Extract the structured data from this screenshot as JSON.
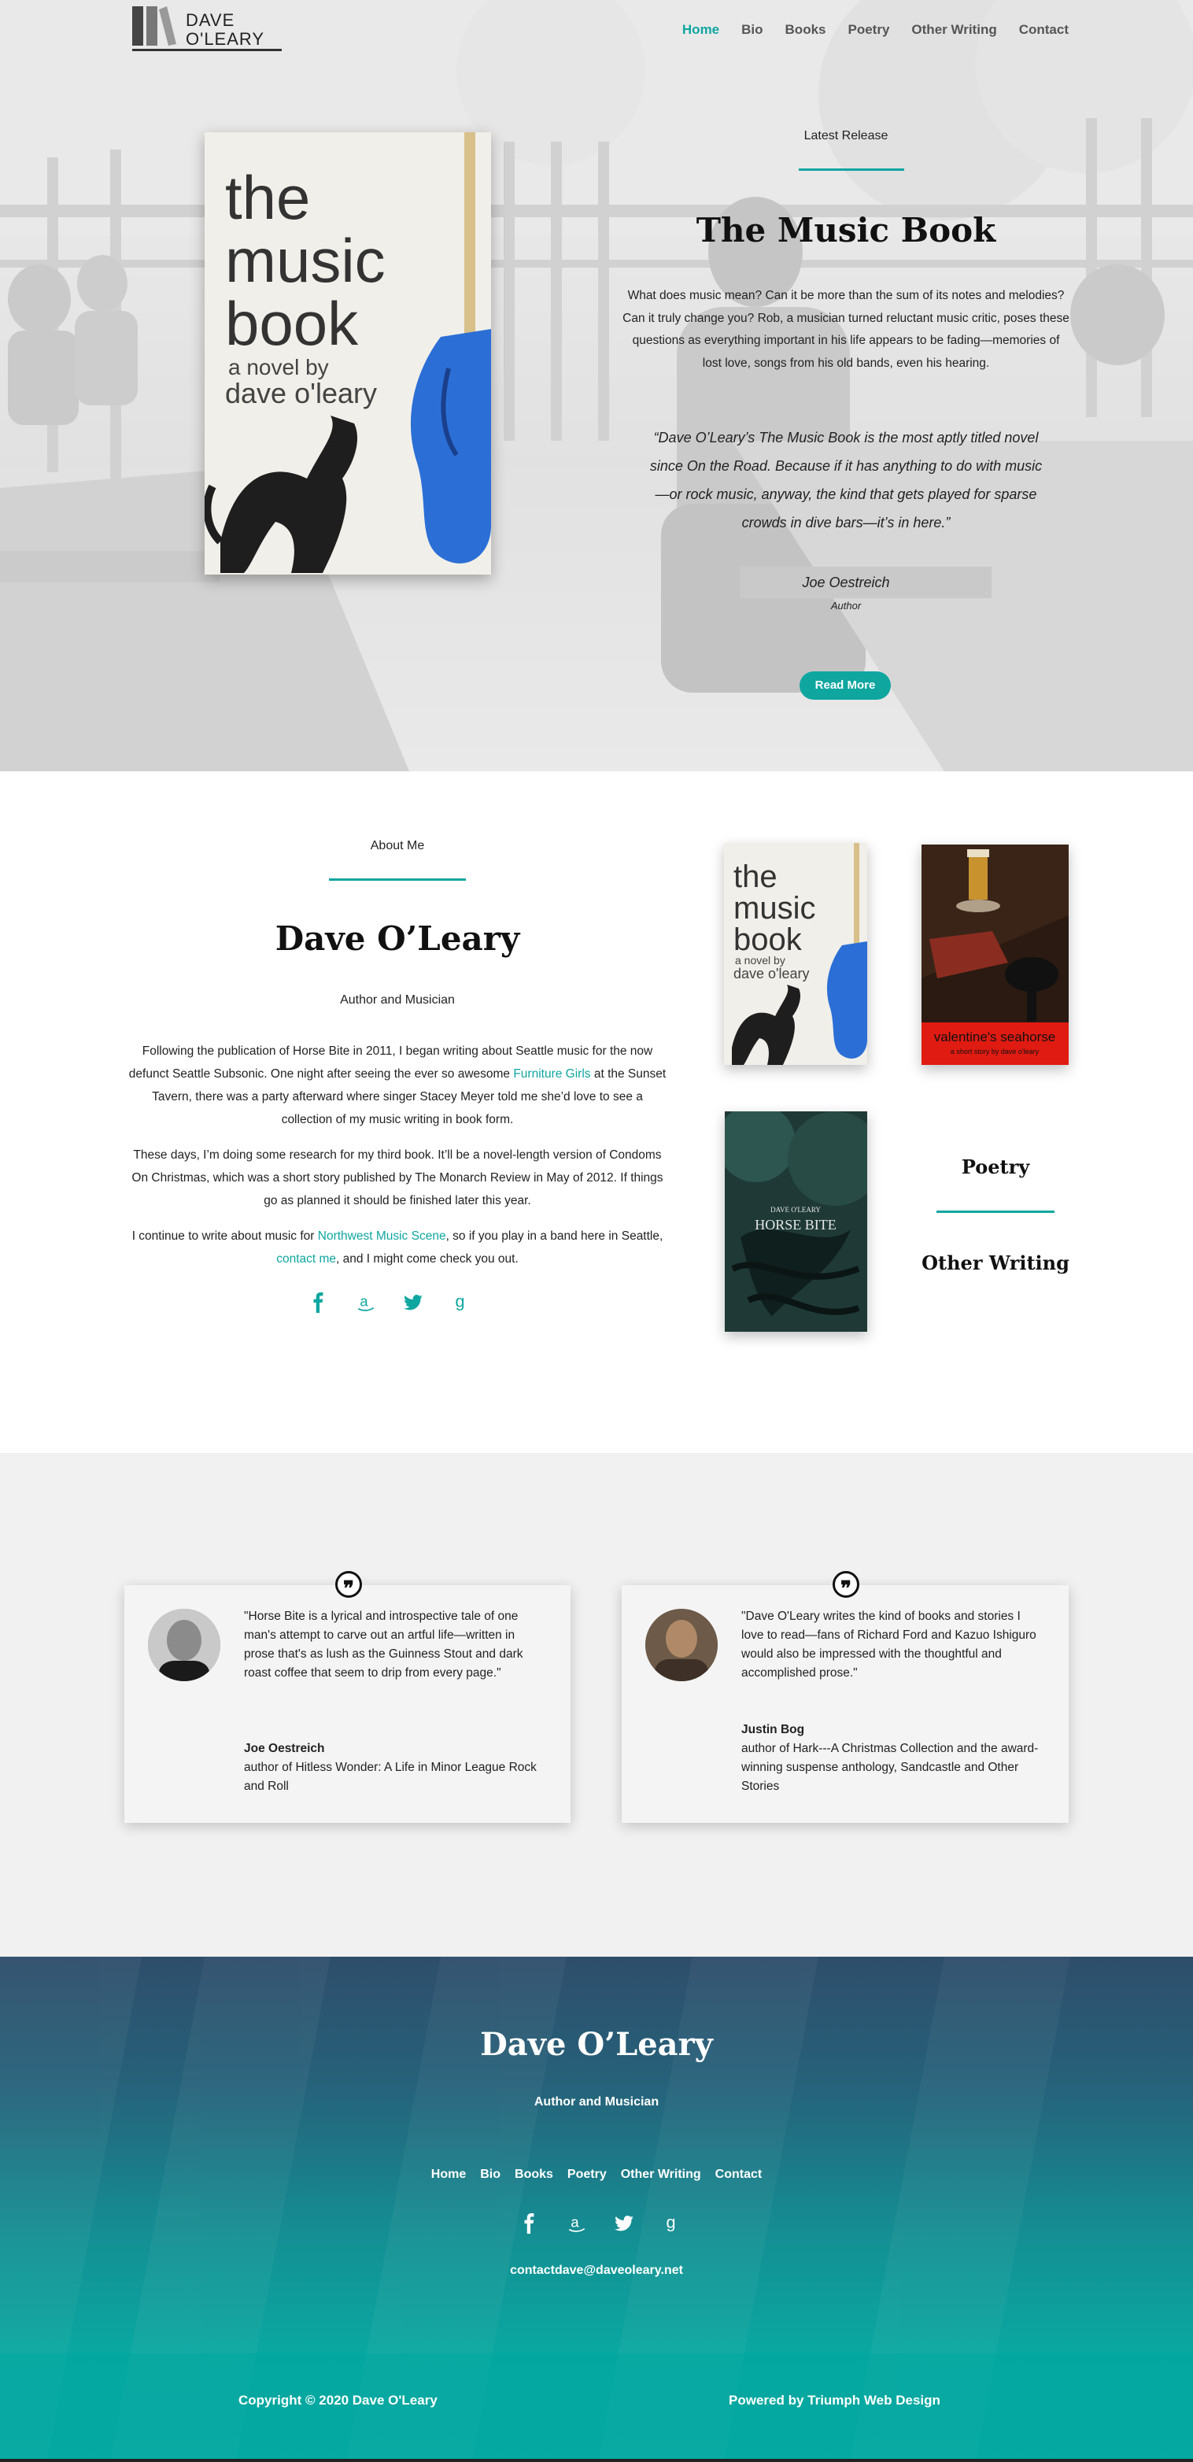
{
  "brand": {
    "logo_line1": "DAVE",
    "logo_line2": "O'LEARY"
  },
  "nav": {
    "items": [
      "Home",
      "Bio",
      "Books",
      "Poetry",
      "Other Writing",
      "Contact"
    ],
    "active": "Home"
  },
  "hero": {
    "cover": {
      "line1": "the",
      "line2": "music",
      "line3": "book",
      "byline1": "a novel by",
      "byline2": "dave o'leary"
    },
    "label": "Latest Release",
    "title": "The Music Book",
    "description": "What does music mean? Can it be more than the sum of its notes and melodies? Can it truly change you? Rob, a musician turned reluctant music critic, poses these questions as everything important in his life appears to be fading—memories of lost love, songs from his old bands, even his hearing.",
    "quote": "“Dave O’Leary’s The Music Book is the most aptly titled novel since On the Road. Because if it has anything to do with music—or rock music, anyway, the kind that gets played for sparse crowds in dive bars—it’s in here.”",
    "cite_name": "Joe Oestreich",
    "cite_role": "Author",
    "button": "Read More"
  },
  "about": {
    "label": "About Me",
    "name": "Dave O’Leary",
    "subtitle": "Author and Musician",
    "p1_before": "Following the publication of Horse Bite in 2011, I began writing about Seattle music for the now defunct Seattle Subsonic. One night after seeing the ever so awesome ",
    "p1_link": "Furniture Girls",
    "p1_after": " at the Sunset Tavern, there was a party afterward where singer Stacey Meyer told me she’d love to see a collection of my music writing in book form.",
    "p2": "These days, I’m doing some research for my third book. It’ll be a novel-length version of Condoms On Christmas, which was a short story published by The Monarch Review in May of 2012. If things go as planned it should be finished later this year.",
    "p3_before": "I continue to write about music for ",
    "p3_link1": "Northwest Music Scene",
    "p3_mid": ", so if you play in a band here in Seattle, ",
    "p3_link2": "contact me",
    "p3_after": ", and I might come check you out.",
    "social_icons": [
      "facebook-icon",
      "amazon-icon",
      "twitter-icon",
      "goodreads-icon"
    ]
  },
  "books": {
    "music": {
      "line1": "the",
      "line2": "music",
      "line3": "book",
      "byline1": "a novel by",
      "byline2": "dave o'leary"
    },
    "valentine": {
      "title": "valentine's seahorse",
      "byline": "a short story by dave o'leary"
    },
    "horse": {
      "author": "DAVE O'LEARY",
      "title": "HORSE BITE"
    }
  },
  "side_links": {
    "poetry": "Poetry",
    "other": "Other Writing"
  },
  "testimonials": [
    {
      "quote": "\"Horse Bite is a lyrical and introspective tale of one man's attempt to carve out an artful life—written in prose that's as lush as the Guinness Stout and dark roast coffee that seem to drip from every page.\"",
      "name": "Joe Oestreich",
      "role": "author of Hitless Wonder: A Life in Minor League Rock and Roll"
    },
    {
      "quote": "\"Dave O'Leary writes the kind of books and stories I love to read—fans of Richard Ford and Kazuo Ishiguro would also be impressed with the thoughtful and accomplished prose.\"",
      "name": "Justin Bog",
      "role": "author of Hark---A Christmas Collection and the award-winning suspense anthology, Sandcastle and Other Stories"
    }
  ],
  "footer": {
    "name": "Dave O’Leary",
    "subtitle": "Author and Musician",
    "menu": [
      "Home",
      "Bio",
      "Books",
      "Poetry",
      "Other Writing",
      "Contact"
    ],
    "email": "contactdave@daveoleary.net",
    "copyright": "Copyright © 2020 Dave O'Leary",
    "powered": "Powered by Triumph Web Design"
  },
  "colors": {
    "accent": "#0fa6a0",
    "footer_top": "#2e4e6b",
    "footer_bottom": "#09aaa3"
  }
}
